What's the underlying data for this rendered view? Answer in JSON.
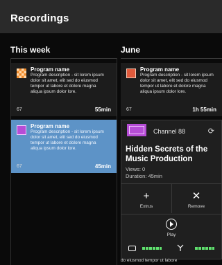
{
  "header": {
    "title": "Recordings"
  },
  "columns": {
    "this_week": "This week",
    "june": "June"
  },
  "cards": [
    {
      "title": "Program name",
      "description": "Program description - sit lorem ipsum dolor sit amet, elit sed do eiusmod tempor ut labore et dolore magna aliqua ipsum dolor lore.",
      "count": "67",
      "duration": "55min",
      "thumb_color": "#f08a2a"
    },
    {
      "title": "Program name",
      "description": "Program description - sit lorem ipsum dolor sit amet, elit sed do eiusmod tempor ut labore et dolore magna aliqua ipsum dolor lore.",
      "count": "67",
      "duration": "1h 55min",
      "thumb_color": "#e05a3c"
    },
    {
      "title": "Program name",
      "description": "Program description - sit lorem ipsum dolor sit amet, elit sed do eiusmod tempor ut labore et dolore magna aliqua ipsum dolor lore.",
      "count": "67",
      "duration": "45min",
      "thumb_color": "#b64dd6"
    }
  ],
  "popup": {
    "channel": "Channel 88",
    "title": "Hidden Secrets of the Music Production",
    "views": "Views: 0",
    "duration": "Duration: 45min",
    "actions": {
      "extras": "Extrus",
      "remove": "Remove",
      "play": "Play"
    }
  },
  "bottom_text": "do eiusmod tempor ut labore",
  "colors": {
    "selected": "#5d93c7",
    "accent": "#b64dd6",
    "signal": "#5fe16e"
  }
}
